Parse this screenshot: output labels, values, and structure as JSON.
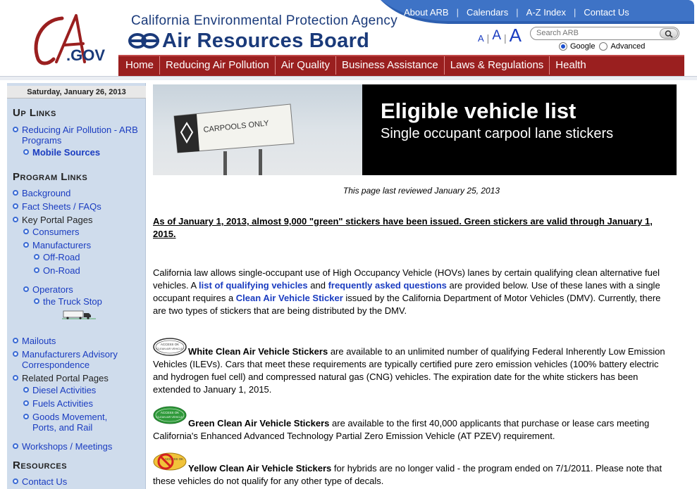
{
  "header": {
    "logo_text": "CA.GOV",
    "agency": "California Environmental Protection Agency",
    "board": "Air Resources Board",
    "utility_links": [
      "About ARB",
      "Calendars",
      "A-Z Index",
      "Contact Us"
    ],
    "text_size": [
      "A",
      "A",
      "A"
    ],
    "search": {
      "placeholder": "Search ARB",
      "option_google": "Google",
      "option_advanced": "Advanced"
    },
    "nav": [
      "Home",
      "Reducing Air Pollution",
      "Air Quality",
      "Business Assistance",
      "Laws & Regulations",
      "Health"
    ],
    "colors": {
      "brand_blue": "#1a3a7a",
      "nav_red": "#9a1f1f",
      "link_blue": "#1a3cc0"
    }
  },
  "sidebar": {
    "date": "Saturday, January 26, 2013",
    "up_links_heading": "Up Links",
    "up_links": [
      "Reducing Air Pollution - ARB Programs",
      "Mobile Sources"
    ],
    "program_links_heading": "Program Links",
    "program_links": {
      "background": "Background",
      "fact_sheets": "Fact Sheets / FAQs",
      "key_portal": "Key Portal Pages",
      "consumers": "Consumers",
      "manufacturers": "Manufacturers",
      "off_road": "Off-Road",
      "on_road": "On-Road",
      "operators": "Operators",
      "truck_stop": "the Truck Stop",
      "mailouts": "Mailouts",
      "mfr_advisory": "Manufacturers Advisory Correspondence",
      "related_portal": "Related Portal Pages",
      "diesel": "Diesel Activities",
      "fuels": "Fuels Activities",
      "goods": "Goods Movement, Ports, and Rail",
      "workshops": "Workshops / Meetings"
    },
    "resources_heading": "Resources",
    "contact_us": "Contact Us"
  },
  "content": {
    "banner_sign": "CARPOOLS ONLY",
    "banner_title": "Eligible vehicle list",
    "banner_subtitle": "Single occupant carpool lane stickers",
    "last_reviewed": "This page last reviewed January 25, 2013",
    "notice": "As of January 1, 2013, almost 9,000 \"green\" stickers have been issued. Green stickers are valid through January 1, 2015.",
    "intro": {
      "p1": "California law allows single-occupant use of High Occupancy Vehicle (HOVs) lanes by certain qualifying clean alternative fuel vehicles. A ",
      "link1": "list of qualifying vehicles",
      "p2": " and ",
      "link2": "frequently asked questions",
      "p3": " are provided below. Use of these lanes with a single occupant requires a ",
      "link3": "Clean Air Vehicle Sticker",
      "p4": " issued by the California Department of Motor Vehicles (DMV). Currently, there are two types of stickers that are being distributed by the DMV."
    },
    "white": {
      "title": "White Clean Air Vehicle Stickers",
      "text": " are available to an unlimited number of qualifying Federal Inherently Low Emission Vehicles (ILEVs). Cars that meet these requirements are typically certified pure zero emission vehicles (100% battery electric and hydrogen fuel cell) and compressed natural gas (CNG) vehicles. The expiration date for the white stickers has been extended to January 1, 2015."
    },
    "green": {
      "title": "Green Clean Air Vehicle Stickers",
      "text": " are available to the first 40,000 applicants that purchase or lease cars meeting California's Enhanced Advanced Technology Partial Zero Emission Vehicle (AT PZEV) requirement."
    },
    "yellow": {
      "title": "Yellow Clean Air Vehicle Stickers",
      "text": " for hybrids are no longer valid - the program ended on 7/1/2011. Please note that these vehicles do not qualify for any other type of decals."
    },
    "sticker_label": "ACCESS OK CLEAN AIR VEHICLE"
  }
}
